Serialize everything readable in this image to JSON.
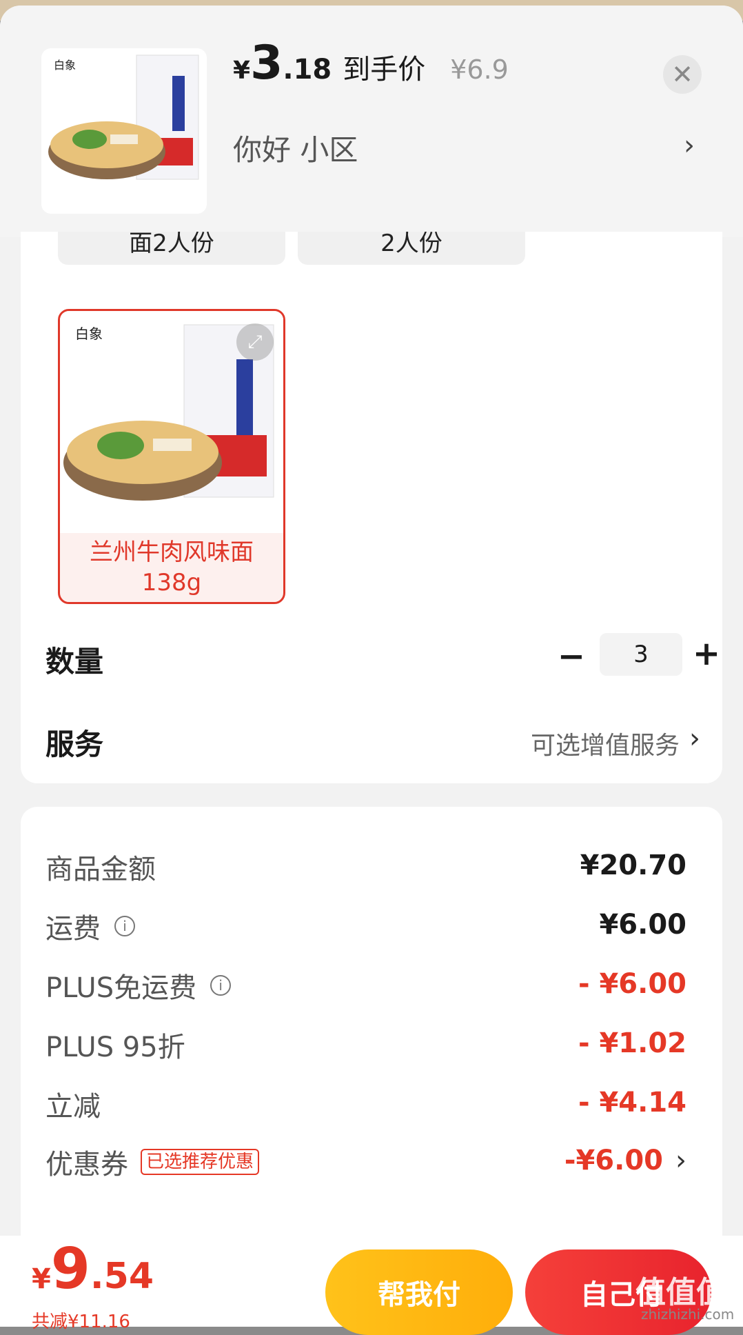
{
  "header": {
    "price": {
      "currency": "¥",
      "integer": "3",
      "decimal": ".18"
    },
    "price_label": "到手价",
    "original_price": "¥6.9",
    "address": "你好  小区",
    "address_chevron": "›",
    "close_icon": "close-icon"
  },
  "specs": {
    "option1": "面2人份",
    "option2": "2人份",
    "selected_label": "兰州牛肉风味面138g"
  },
  "quantity": {
    "label": "数量",
    "value": "3",
    "minus": "−",
    "plus": "+"
  },
  "service": {
    "label": "服务",
    "value": "可选增值服务",
    "chevron": "›"
  },
  "price_lines": [
    {
      "label": "商品金额",
      "value": "¥20.70"
    },
    {
      "label": "运费",
      "value": "¥6.00"
    },
    {
      "label": "PLUS免运费",
      "value": "- ¥6.00"
    },
    {
      "label": "PLUS 95折",
      "value": "- ¥1.02"
    },
    {
      "label": "立减",
      "value": "- ¥4.14"
    },
    {
      "label": "优惠券",
      "badge": "已选推荐优惠",
      "value": "-¥6.00"
    }
  ],
  "bottom": {
    "total": {
      "currency": "¥",
      "integer": "9",
      "decimal": ".54"
    },
    "saved": "共减¥11.16",
    "help_pay": "帮我付",
    "self_pay": "自己付"
  },
  "watermark": {
    "text": "值值值",
    "url": "zhizhizhi.com"
  },
  "colors": {
    "accent_red": "#e53826",
    "help_yellow": "#ffc21a"
  }
}
